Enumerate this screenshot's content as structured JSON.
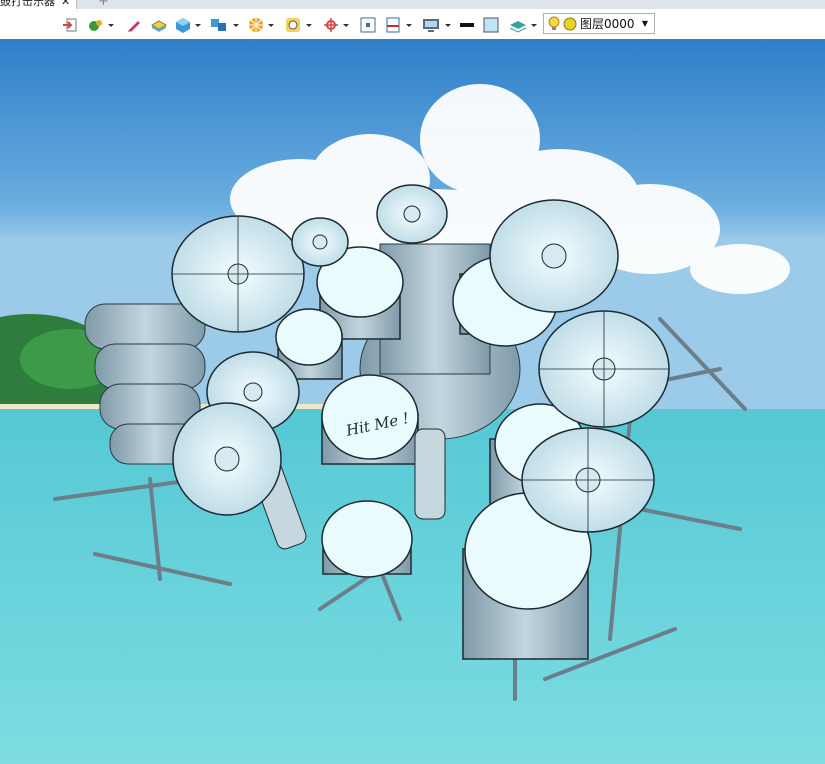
{
  "tab": {
    "title": "鼓打击乐器",
    "close": "✕",
    "new_tab": "+"
  },
  "toolbar": {
    "tools": [
      {
        "name": "exit-tool",
        "color": "#d04646"
      },
      {
        "name": "material-tool",
        "color": "#3a9a3a"
      },
      {
        "name": "pen-tool",
        "color": "#c93a5a"
      },
      {
        "name": "block-tool",
        "color": "#e0b020"
      },
      {
        "name": "cube-tool",
        "color": "#2a8ad0"
      },
      {
        "name": "multi-view-tool",
        "color": "#2a8ad0"
      },
      {
        "name": "render-style-tool",
        "color": "#f0a020"
      },
      {
        "name": "search-tool",
        "color": "#e0b020"
      },
      {
        "name": "axis-tool",
        "color": "#d04646"
      },
      {
        "name": "snap-tool",
        "color": "#4a6a8a"
      },
      {
        "name": "frame-tool",
        "color": "#c03030"
      },
      {
        "name": "display-tool",
        "color": "#5a6a7a"
      },
      {
        "name": "line-style-tool",
        "color": "#111111"
      },
      {
        "name": "fill-color-tool",
        "color": "#bfe3f7"
      },
      {
        "name": "layer-stack-tool",
        "color": "#3aa0a0"
      }
    ],
    "layer": {
      "label": "图层0000",
      "bulb_color": "#f7d54a",
      "state_color": "#e8d22a"
    }
  },
  "drawing": {
    "annotation_text": "Hit Me !",
    "colors": {
      "sky": "#5d9fd8",
      "water": "#6fd6dc",
      "metal": "#a9c3cf",
      "head": "#e7fbfd"
    }
  }
}
